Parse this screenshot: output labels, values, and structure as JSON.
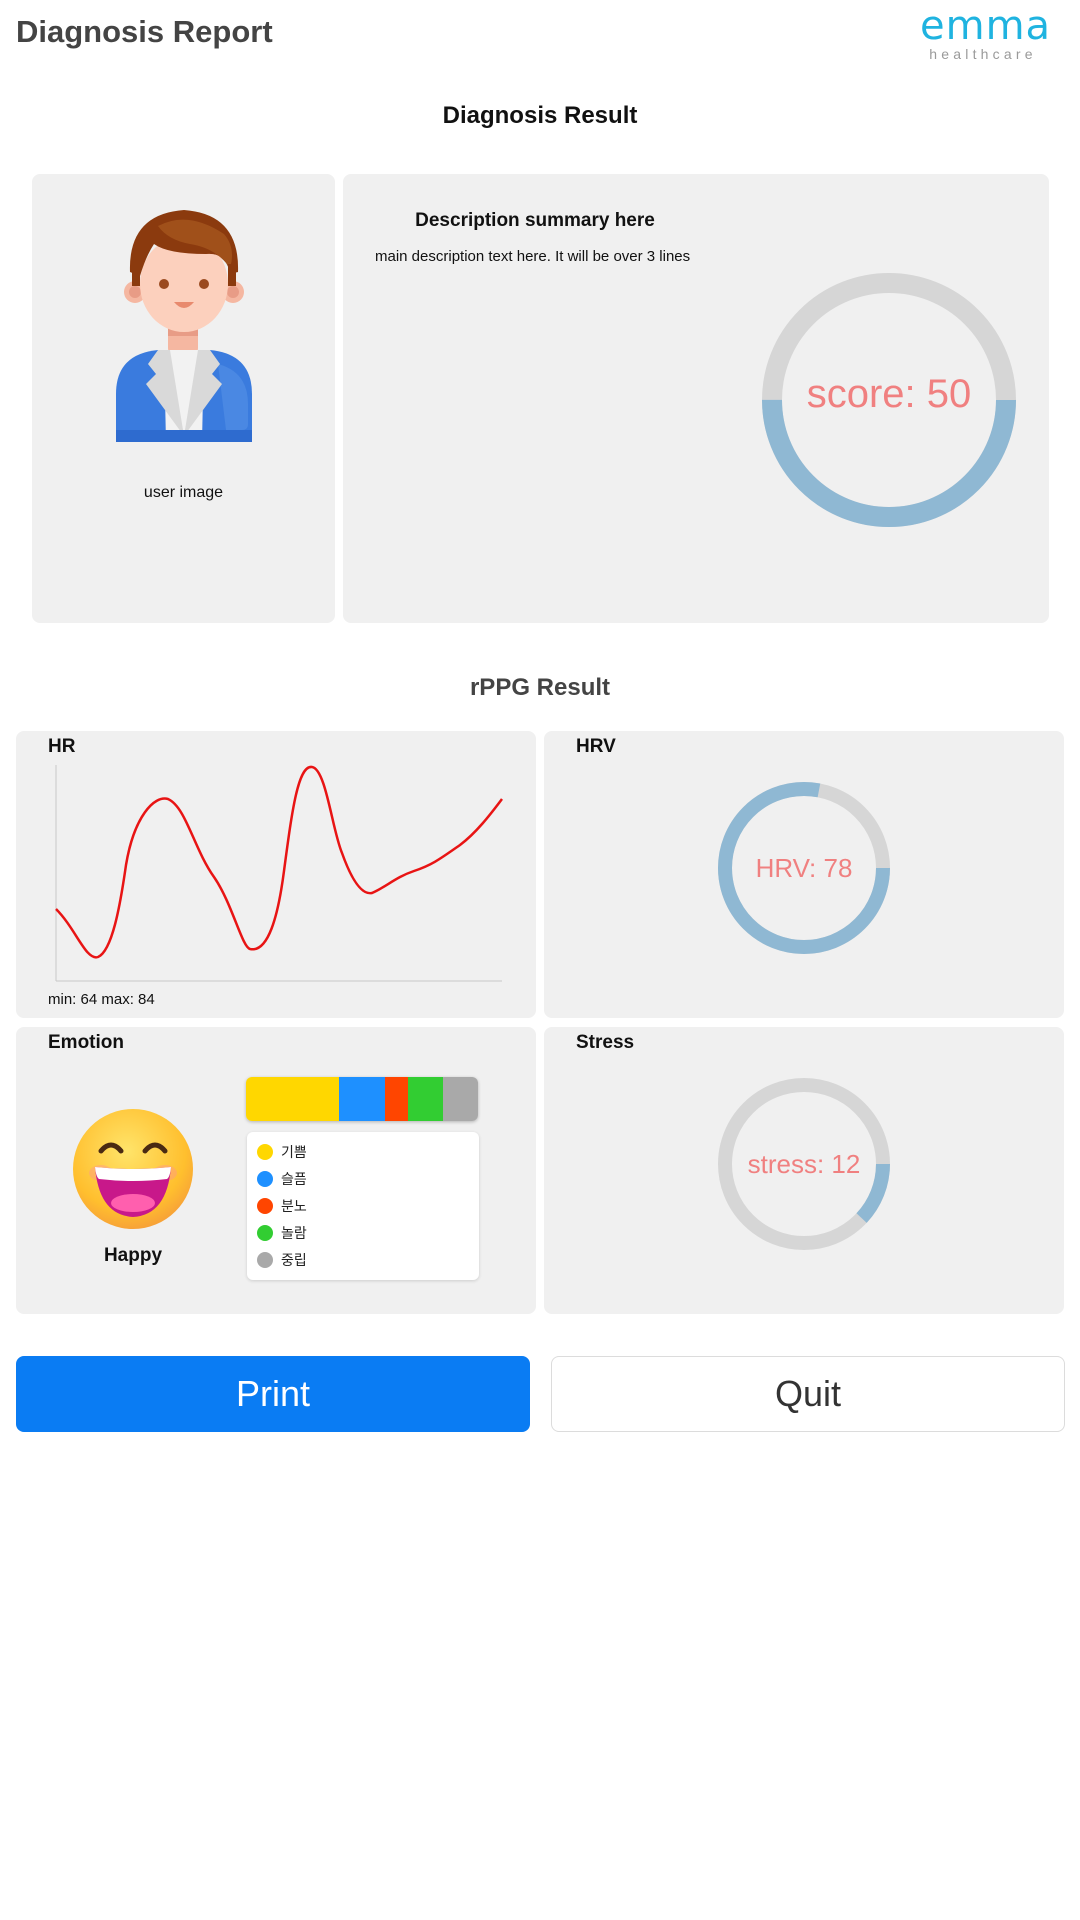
{
  "header": {
    "title": "Diagnosis Report",
    "logo_main": "emma",
    "logo_sub": "healthcare"
  },
  "diagnosis": {
    "section_title": "Diagnosis Result",
    "user_image_label": "user image",
    "summary_title": "Description summary here",
    "description": "main description text here. It will be over 3 lines",
    "score_label": "score: 50",
    "score_value": 50,
    "score_max": 100
  },
  "rppg": {
    "section_title": "rPPG Result",
    "hr": {
      "title": "HR",
      "stats": "min: 64 max: 84"
    },
    "hrv": {
      "title": "HRV",
      "label": "HRV: 78",
      "fraction": 0.78
    },
    "stress": {
      "title": "Stress",
      "label": "stress: 12",
      "fraction": 0.12
    },
    "emotion": {
      "title": "Emotion",
      "result": "Happy",
      "segments": [
        {
          "label": "기쁨",
          "color": "#ffd700",
          "share": 0.4
        },
        {
          "label": "슬픔",
          "color": "#1e90ff",
          "share": 0.2
        },
        {
          "label": "분노",
          "color": "#ff4500",
          "share": 0.1
        },
        {
          "label": "놀람",
          "color": "#32cd32",
          "share": 0.15
        },
        {
          "label": "중립",
          "color": "#a9a9a9",
          "share": 0.15
        }
      ]
    }
  },
  "buttons": {
    "print": "Print",
    "quit": "Quit"
  },
  "colors": {
    "accent": "#0a7cf3",
    "donut_fill": "#8fb8d3",
    "donut_track": "#d6d6d6",
    "donut_text": "#f08080",
    "hr_line": "#e81414",
    "logo": "#1fb3e0"
  },
  "icons": {
    "user_avatar": "businessman-avatar-icon",
    "emotion": "grinning-face-icon"
  }
}
